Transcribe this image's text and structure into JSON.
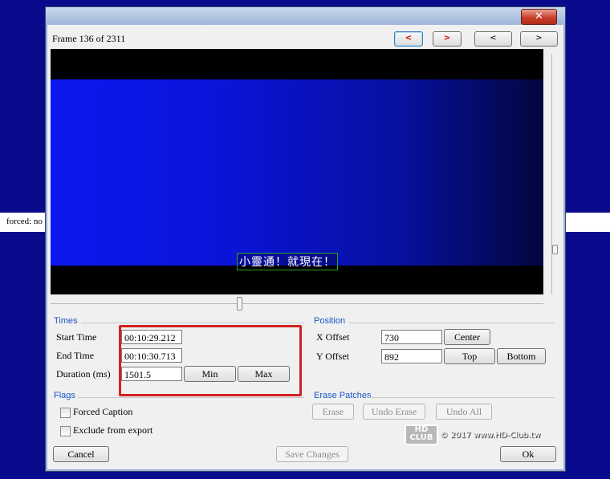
{
  "background": {
    "side_text": "forced: no"
  },
  "window": {
    "close_glyph": "✕"
  },
  "header": {
    "frame_label": "Frame 136 of 2311",
    "nav_buttons": [
      "<",
      ">",
      "<",
      ">"
    ]
  },
  "video": {
    "subtitle": "小靈通！就現在！"
  },
  "times": {
    "title": "Times",
    "start_label": "Start Time",
    "start_value": "00:10:29.212",
    "end_label": "End Time",
    "end_value": "00:10:30.713",
    "duration_label": "Duration (ms)",
    "duration_value": "1501.5",
    "min_label": "Min",
    "max_label": "Max"
  },
  "position": {
    "title": "Position",
    "x_label": "X Offset",
    "x_value": "730",
    "y_label": "Y Offset",
    "y_value": "892",
    "center_label": "Center",
    "top_label": "Top",
    "bottom_label": "Bottom"
  },
  "flags": {
    "title": "Flags",
    "forced_label": "Forced Caption",
    "exclude_label": "Exclude from export"
  },
  "erase": {
    "title": "Erase Patches",
    "erase_label": "Erase",
    "undo_erase_label": "Undo Erase",
    "undo_all_label": "Undo All"
  },
  "footer": {
    "cancel_label": "Cancel",
    "save_label": "Save Changes",
    "ok_label": "Ok"
  },
  "watermark": {
    "logo_text": "HD CLUB",
    "text": "© 2017 www.HD-Club.tw"
  }
}
